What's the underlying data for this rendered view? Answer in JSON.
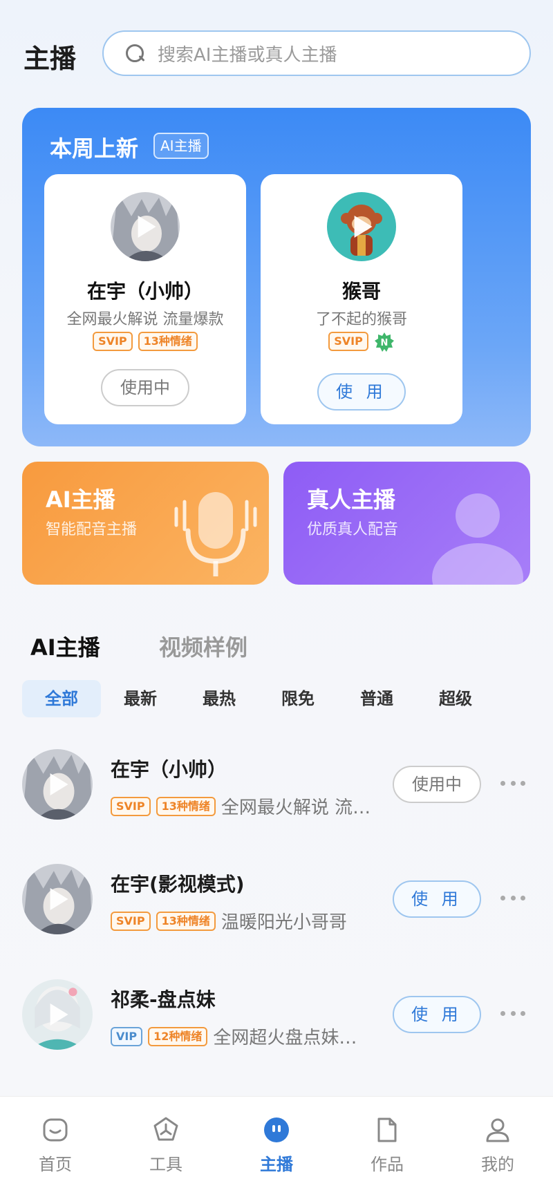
{
  "header": {
    "title": "主播",
    "search_placeholder": "搜索AI主播或真人主播"
  },
  "weekly": {
    "title": "本周上新",
    "badge": "AI主播",
    "cards": [
      {
        "name": "在宇（小帅）",
        "desc": "全网最火解说 流量爆款",
        "tags": [
          "SVIP",
          "13种情绪"
        ],
        "button": "使用中"
      },
      {
        "name": "猴哥",
        "desc": "了不起的猴哥",
        "tags": [
          "SVIP"
        ],
        "new_badge": "N",
        "button": "使 用"
      }
    ]
  },
  "categories": {
    "ai": {
      "title": "AI主播",
      "subtitle": "智能配音主播"
    },
    "human": {
      "title": "真人主播",
      "subtitle": "优质真人配音"
    }
  },
  "tabs": {
    "ai": "AI主播",
    "video": "视频样例"
  },
  "filters": [
    "全部",
    "最新",
    "最热",
    "限免",
    "普通",
    "超级"
  ],
  "list": [
    {
      "name": "在宇（小帅）",
      "tag1": "SVIP",
      "tag2": "13种情绪",
      "desc": "全网最火解说 流…",
      "button": "使用中"
    },
    {
      "name": "在宇(影视模式)",
      "tag1": "SVIP",
      "tag2": "13种情绪",
      "desc": "温暖阳光小哥哥",
      "button": "使 用"
    },
    {
      "name": "祁柔-盘点妹",
      "tag1": "VIP",
      "tag2": "12种情绪",
      "desc": "全网超火盘点妹…",
      "button": "使 用"
    }
  ],
  "nav": [
    "首页",
    "工具",
    "主播",
    "作品",
    "我的"
  ],
  "colors": {
    "accent": "#2f79d8",
    "orange": "#f89a3e",
    "purple": "#8e5cf5"
  }
}
